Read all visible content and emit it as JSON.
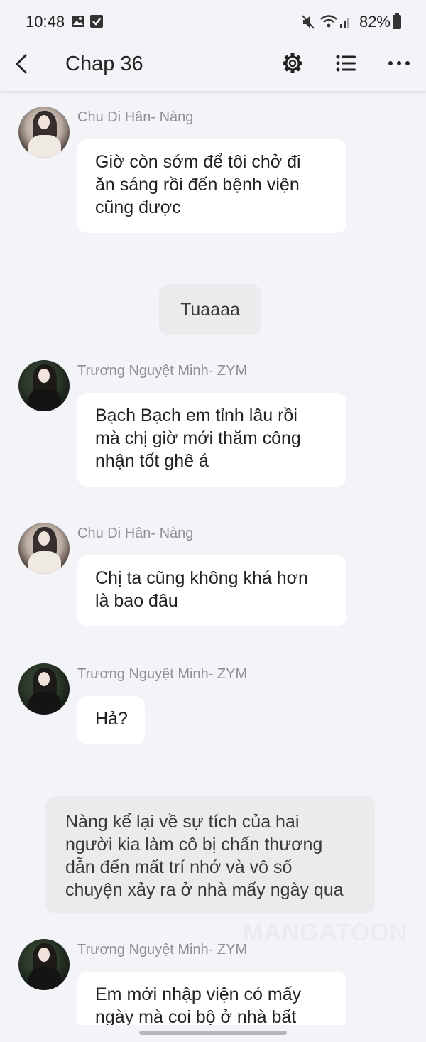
{
  "status_bar": {
    "time": "10:48",
    "battery": "82%"
  },
  "header": {
    "title": "Chap 36"
  },
  "messages": [
    {
      "speaker": "Chu Di Hân- Nàng",
      "lines": [
        "Giờ còn sớm để tôi chở đi",
        "ăn sáng rồi đến bệnh viện",
        "cũng được"
      ]
    },
    {
      "narration": "Tuaaaa"
    },
    {
      "speaker": "Trương Nguyệt Minh- ZYM",
      "lines": [
        "Bạch Bạch em tỉnh lâu rồi",
        "mà chị giờ mới thăm công",
        "nhận tốt ghê á"
      ]
    },
    {
      "speaker": "Chu Di Hân- Nàng",
      "lines": [
        "Chị ta cũng không khá hơn",
        "là bao đâu"
      ]
    },
    {
      "speaker": "Trương Nguyệt Minh- ZYM",
      "lines": [
        "Hả?"
      ]
    },
    {
      "narration_lines": [
        "Nàng kể lại về sự tích của hai",
        "người kia làm cô bị chấn thương",
        "dẫn đến mất trí nhớ và vô số",
        "chuyện xảy ra ở nhà mấy ngày qua"
      ]
    },
    {
      "speaker": "Trương Nguyệt Minh- ZYM",
      "lines": [
        "Em mới nhập viện có mấy",
        "ngày mà coi bộ ở nhà bất"
      ]
    }
  ],
  "watermark": "MANGATOON",
  "colors": {
    "background": "#f3f4f7",
    "bubble": "#ffffff",
    "narration": "#ebebed",
    "speaker_name": "#8d8f95"
  },
  "icons": [
    "back-arrow-icon",
    "gear-icon",
    "list-icon",
    "more-dots-icon",
    "image-icon",
    "checkbox-icon",
    "mute-icon",
    "wifi-icon",
    "signal-icon",
    "battery-icon"
  ]
}
